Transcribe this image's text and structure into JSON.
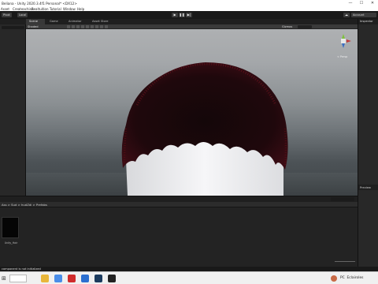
{
  "window": {
    "title": "Beliana - Unity 2020.3.4f1 Personal* <DX12>",
    "min_glyph": "—",
    "max_glyph": "☐",
    "close_glyph": "✕"
  },
  "menu": {
    "items": [
      "Asset",
      "Createachina",
      "Realtuition",
      "Tutorial",
      "Window",
      "Help"
    ]
  },
  "toolbar": {
    "pivot_label": "Pivot",
    "local_label": "Local",
    "play_glyph": "▶",
    "pause_glyph": "❚❚",
    "step_glyph": "▶|",
    "account_label": "Account",
    "layers_glyph": "≡"
  },
  "scene": {
    "tabs": [
      "Scene",
      "Game",
      "Animator",
      "Asset Store"
    ],
    "shading_mode": "Shaded",
    "gizmos_label": "Gizmos",
    "gizmo_caption": "< Persp"
  },
  "inspector": {
    "tab_label": "Inspector",
    "preview_label": "Preview"
  },
  "project": {
    "breadcrumb": "Ass > Sud > hudZdi > Prefabs",
    "asset_label": "Unity_Hair"
  },
  "status": {
    "message": "component is not initialized"
  },
  "taskbar": {
    "user_label": "PC",
    "status_label": "Eclairoles",
    "apps": [
      {
        "name": "file-explorer-icon",
        "color": "#e8b63b"
      },
      {
        "name": "chrome-icon",
        "color": "#4a8de8"
      },
      {
        "name": "opera-icon",
        "color": "#d02b2b"
      },
      {
        "name": "editor-icon",
        "color": "#2b6fd0"
      },
      {
        "name": "steam-icon",
        "color": "#1c3b5e"
      },
      {
        "name": "unity-icon",
        "color": "#222222"
      }
    ]
  },
  "colors": {
    "editor_dark": "#282828",
    "sky_top": "#aeb0b2",
    "hair_dark": "#1a0a0c",
    "hair_tip": "#7a1420",
    "head": "#f2f2f4"
  }
}
